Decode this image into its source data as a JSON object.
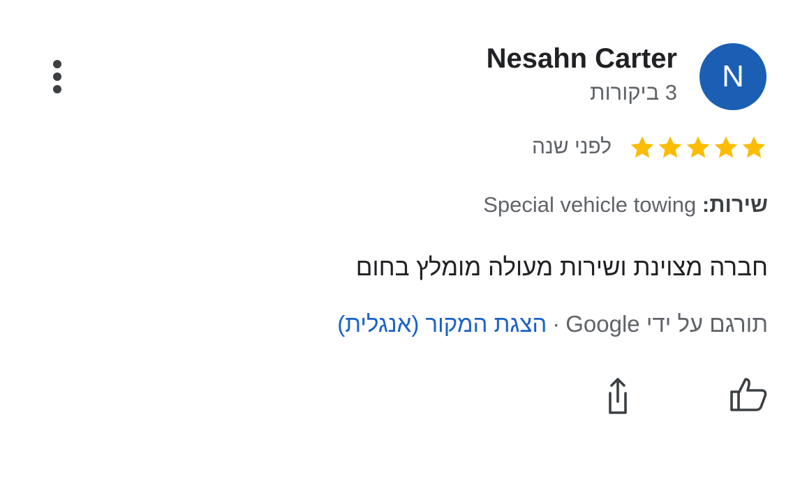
{
  "review": {
    "author": {
      "avatar_letter": "N",
      "avatar_color": "#1a5fb4",
      "name": "Nesahn Carter",
      "review_count": "3 ביקורות"
    },
    "rating": {
      "stars": 5,
      "star_color": "#fbbc04",
      "time_ago": "לפני שנה"
    },
    "service": {
      "label": "שירות:",
      "value": "Special vehicle towing"
    },
    "text": "חברה מצוינת ושירות מעולה מומלץ בחום",
    "translation": {
      "note": "תורגם על ידי Google",
      "separator": "·",
      "show_original_link": "הצגת המקור (אנגלית)",
      "link_color": "#1a62c9"
    },
    "actions": {
      "like_icon": "thumbs-up-icon",
      "share_icon": "share-icon",
      "more_icon": "more-vert-icon"
    }
  }
}
